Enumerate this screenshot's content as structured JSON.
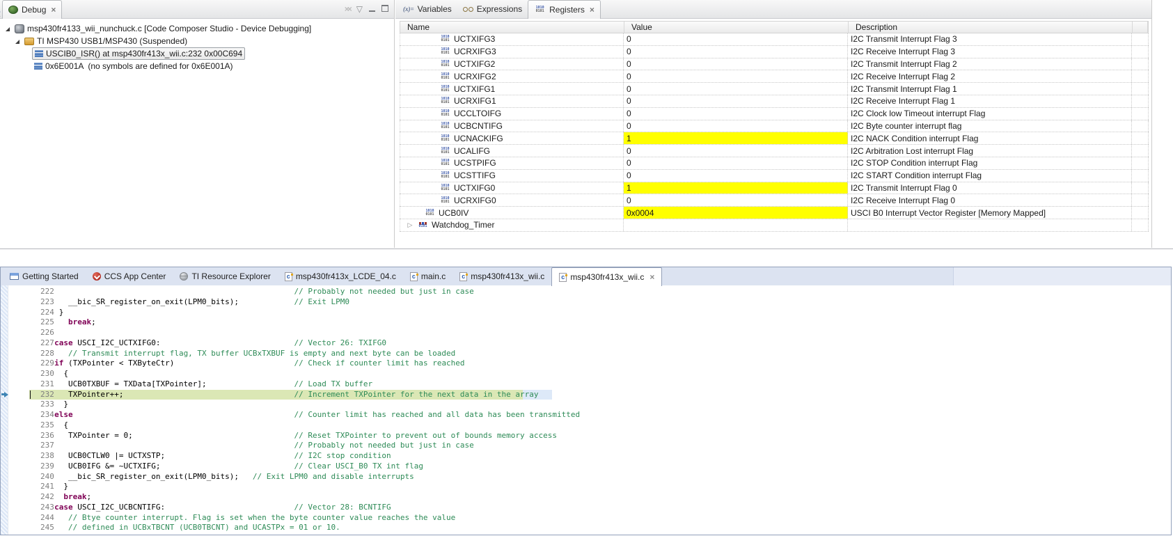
{
  "colors": {
    "value_highlight": "#ffff00",
    "current_line_highlight": "#dbe7b5",
    "selection_extension": "#dde9f8",
    "comment_green": "#2e8b57",
    "keyword_purple": "#7f0055",
    "editor_tabbar": "#dce3f1"
  },
  "debug": {
    "tab_label": "Debug",
    "tree": [
      {
        "label": "msp430fr4133_wii_nunchuck.c [Code Composer Studio - Device Debugging]",
        "icon": "debug-target",
        "level": 0,
        "expanded": true
      },
      {
        "label": "TI MSP430 USB1/MSP430 (Suspended)",
        "icon": "device",
        "level": 1,
        "expanded": true
      },
      {
        "label": "USCIB0_ISR() at msp430fr413x_wii.c:232 0x00C694",
        "icon": "stack-frame",
        "level": 2,
        "selected": true
      },
      {
        "label": "0x6E001A  (no symbols are defined for 0x6E001A)",
        "icon": "stack-frame",
        "level": 2
      }
    ]
  },
  "registers": {
    "tabs": [
      {
        "label": "Variables"
      },
      {
        "label": "Expressions"
      },
      {
        "label": "Registers",
        "active": true
      }
    ],
    "columns": [
      "Name",
      "Value",
      "Description"
    ],
    "rows": [
      {
        "name": "UCTXIFG3",
        "value": "0",
        "desc": "I2C Transmit Interrupt Flag 3",
        "kind": "bit"
      },
      {
        "name": "UCRXIFG3",
        "value": "0",
        "desc": "I2C Receive Interrupt Flag 3",
        "kind": "bit"
      },
      {
        "name": "UCTXIFG2",
        "value": "0",
        "desc": "I2C Transmit Interrupt Flag 2",
        "kind": "bit"
      },
      {
        "name": "UCRXIFG2",
        "value": "0",
        "desc": "I2C Receive Interrupt Flag 2",
        "kind": "bit"
      },
      {
        "name": "UCTXIFG1",
        "value": "0",
        "desc": "I2C Transmit Interrupt Flag 1",
        "kind": "bit"
      },
      {
        "name": "UCRXIFG1",
        "value": "0",
        "desc": "I2C Receive Interrupt Flag 1",
        "kind": "bit"
      },
      {
        "name": "UCCLTOIFG",
        "value": "0",
        "desc": "I2C Clock low Timeout interrupt Flag",
        "kind": "bit"
      },
      {
        "name": "UCBCNTIFG",
        "value": "0",
        "desc": "I2C Byte counter interrupt flag",
        "kind": "bit"
      },
      {
        "name": "UCNACKIFG",
        "value": "1",
        "desc": "I2C NACK Condition interrupt Flag",
        "kind": "bit",
        "highlight": true
      },
      {
        "name": "UCALIFG",
        "value": "0",
        "desc": "I2C Arbitration Lost interrupt Flag",
        "kind": "bit"
      },
      {
        "name": "UCSTPIFG",
        "value": "0",
        "desc": "I2C STOP Condition interrupt Flag",
        "kind": "bit"
      },
      {
        "name": "UCSTTIFG",
        "value": "0",
        "desc": "I2C START Condition interrupt Flag",
        "kind": "bit"
      },
      {
        "name": "UCTXIFG0",
        "value": "1",
        "desc": "I2C Transmit Interrupt Flag 0",
        "kind": "bit",
        "highlight": true
      },
      {
        "name": "UCRXIFG0",
        "value": "0",
        "desc": "I2C Receive Interrupt Flag 0",
        "kind": "bit"
      },
      {
        "name": "UCB0IV",
        "value": "0x0004",
        "desc": "USCI B0 Interrupt Vector Register [Memory Mapped]",
        "kind": "parent",
        "highlight": true
      },
      {
        "name": "Watchdog_Timer",
        "value": "",
        "desc": "",
        "kind": "group"
      }
    ]
  },
  "editor": {
    "tabs": [
      {
        "label": "Getting Started",
        "icon": "window"
      },
      {
        "label": "CCS App Center",
        "icon": "ccs"
      },
      {
        "label": "TI Resource Explorer",
        "icon": "globe"
      },
      {
        "label": "msp430fr413x_LCDE_04.c",
        "icon": "cfile"
      },
      {
        "label": "main.c",
        "icon": "cfile"
      },
      {
        "label": "msp430fr413x_wii.c",
        "icon": "cfile"
      },
      {
        "label": "msp430fr413x_wii.c",
        "icon": "cfile",
        "active": true,
        "closable": true
      }
    ],
    "code": {
      "current_line": 232,
      "lines": [
        {
          "n": 222,
          "segs": [
            [
              "c",
              "// Probably not needed but just in case",
              54
            ]
          ]
        },
        {
          "n": 223,
          "segs": [
            [
              "p",
              "     __bic_SR_register_on_exit(LPM0_bits);"
            ],
            [
              "c",
              "// Exit LPM0",
              54
            ]
          ]
        },
        {
          "n": 224,
          "segs": [
            [
              "p",
              "   }"
            ]
          ]
        },
        {
          "n": 225,
          "segs": [
            [
              "p",
              "     "
            ],
            [
              "k",
              "break"
            ],
            [
              "p",
              ";"
            ]
          ]
        },
        {
          "n": 226,
          "segs": []
        },
        {
          "n": 227,
          "segs": [
            [
              "p",
              "  "
            ],
            [
              "k",
              "case"
            ],
            [
              "p",
              " USCI_I2C_UCTXIFG0:"
            ],
            [
              "c",
              "// Vector 26: TXIFG0",
              54
            ]
          ]
        },
        {
          "n": 228,
          "segs": [
            [
              "p",
              "     "
            ],
            [
              "c",
              "// Transmit interrupt flag, TX buffer UCBxTXBUF is empty and next byte can be loaded"
            ]
          ]
        },
        {
          "n": 229,
          "segs": [
            [
              "p",
              "  "
            ],
            [
              "k",
              "if"
            ],
            [
              "p",
              " (TXPointer < TXByteCtr)"
            ],
            [
              "c",
              "// Check if counter limit has reached",
              54
            ]
          ]
        },
        {
          "n": 230,
          "segs": [
            [
              "p",
              "    {"
            ]
          ]
        },
        {
          "n": 231,
          "segs": [
            [
              "p",
              "     UCB0TXBUF = TXData[TXPointer];"
            ],
            [
              "c",
              "// Load TX buffer",
              54
            ]
          ]
        },
        {
          "n": 232,
          "segs": [
            [
              "p",
              "     TXPointer++;"
            ],
            [
              "c",
              "// Increment TXPointer for the next data in the array",
              54
            ]
          ]
        },
        {
          "n": 233,
          "segs": [
            [
              "p",
              "    }"
            ]
          ]
        },
        {
          "n": 234,
          "segs": [
            [
              "p",
              "  "
            ],
            [
              "k",
              "else"
            ],
            [
              "c",
              "// Counter limit has reached and all data has been transmitted",
              54
            ]
          ]
        },
        {
          "n": 235,
          "segs": [
            [
              "p",
              "    {"
            ]
          ]
        },
        {
          "n": 236,
          "segs": [
            [
              "p",
              "     TXPointer = 0;"
            ],
            [
              "c",
              "// Reset TXPointer to prevent out of bounds memory access",
              54
            ]
          ]
        },
        {
          "n": 237,
          "segs": [
            [
              "c",
              "// Probably not needed but just in case",
              54
            ]
          ]
        },
        {
          "n": 238,
          "segs": [
            [
              "p",
              "     UCB0CTLW0 |= UCTXSTP;"
            ],
            [
              "c",
              "// I2C stop condition",
              54
            ]
          ]
        },
        {
          "n": 239,
          "segs": [
            [
              "p",
              "     UCB0IFG &= ~UCTXIFG;"
            ],
            [
              "c",
              "// Clear USCI_B0 TX int flag",
              54
            ]
          ]
        },
        {
          "n": 240,
          "segs": [
            [
              "p",
              "     __bic_SR_register_on_exit(LPM0_bits);"
            ],
            [
              "c",
              "// Exit LPM0 and disable interrupts",
              45
            ]
          ]
        },
        {
          "n": 241,
          "segs": [
            [
              "p",
              "    }"
            ]
          ]
        },
        {
          "n": 242,
          "segs": [
            [
              "p",
              "    "
            ],
            [
              "k",
              "break"
            ],
            [
              "p",
              ";"
            ]
          ]
        },
        {
          "n": 243,
          "segs": [
            [
              "p",
              "  "
            ],
            [
              "k",
              "case"
            ],
            [
              "p",
              " USCI_I2C_UCBCNTIFG:"
            ],
            [
              "c",
              "// Vector 28: BCNTIFG",
              54
            ]
          ]
        },
        {
          "n": 244,
          "segs": [
            [
              "p",
              "     "
            ],
            [
              "c",
              "// Btye counter interrupt. Flag is set when the byte counter value reaches the value"
            ]
          ]
        },
        {
          "n": 245,
          "segs": [
            [
              "p",
              "     "
            ],
            [
              "c",
              "// defined in UCBxTBCNT (UCB0TBCNT) and UCASTPx = 01 or 10."
            ]
          ]
        }
      ]
    }
  }
}
